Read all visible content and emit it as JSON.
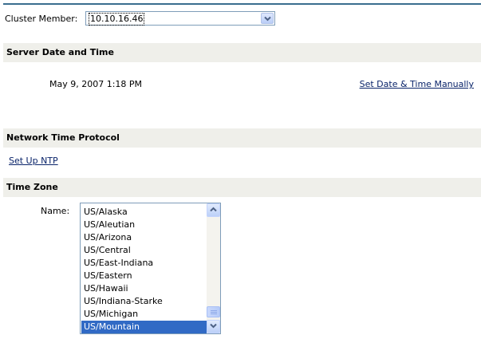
{
  "cluster": {
    "label": "Cluster Member:",
    "selected": "10.10.16.46"
  },
  "server_date_time": {
    "heading": "Server Date and Time",
    "current": "May 9, 2007 1:18 PM",
    "manual_link": "Set Date & Time Manually"
  },
  "ntp": {
    "heading": "Network Time Protocol",
    "setup_link": "Set Up NTP"
  },
  "time_zone": {
    "heading": "Time Zone",
    "name_label": "Name:",
    "options": [
      "US/Alaska",
      "US/Aleutian",
      "US/Arizona",
      "US/Central",
      "US/East-Indiana",
      "US/Eastern",
      "US/Hawaii",
      "US/Indiana-Starke",
      "US/Michigan",
      "US/Mountain"
    ],
    "selected": "US/Mountain"
  },
  "icons": {
    "dropdown": "chevron-down-icon",
    "scroll_up": "chevron-up-icon",
    "scroll_down": "chevron-down-icon"
  },
  "colors": {
    "section_bg": "#efefea",
    "link": "#0a246a",
    "selection": "#316ac5",
    "top_rule": "#3a6e8f"
  }
}
